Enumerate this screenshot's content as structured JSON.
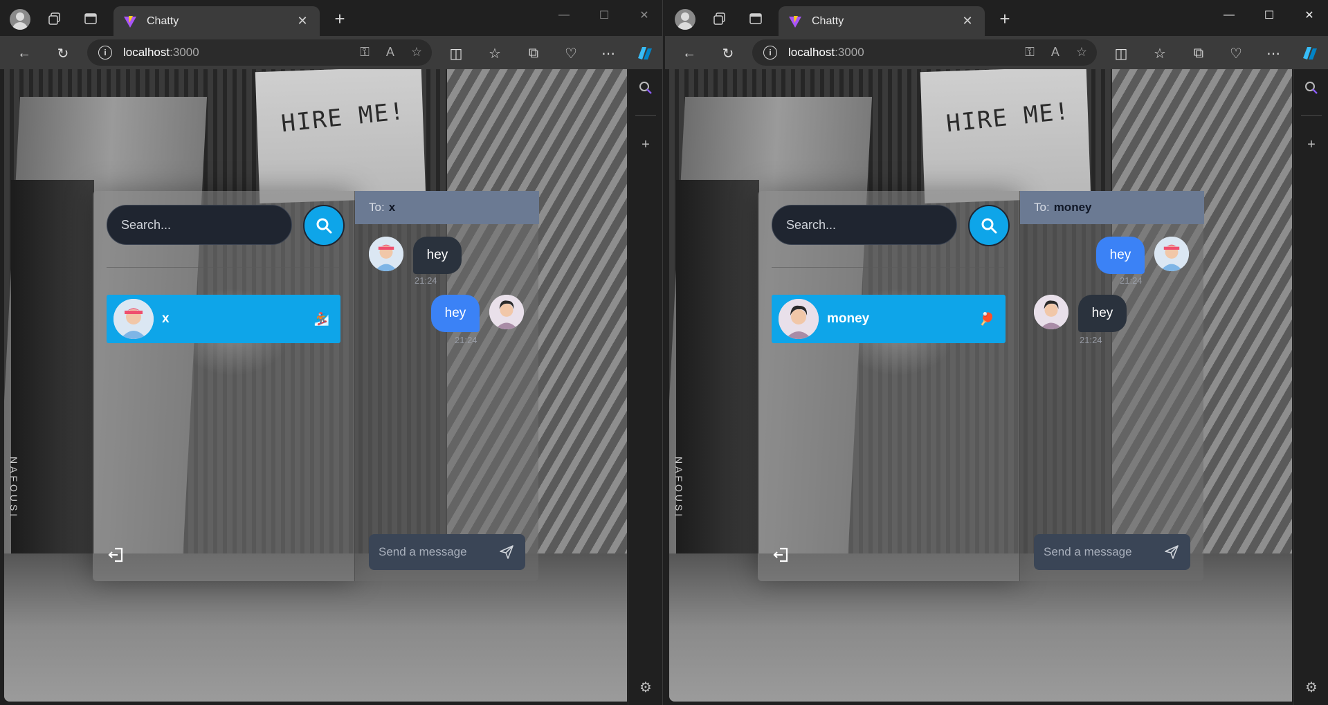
{
  "windows": [
    {
      "tab_title": "Chatty",
      "url_host": "localhost",
      "url_port": ":3000",
      "search_placeholder": "Search...",
      "conversation": {
        "name": "x",
        "emoji": "🏂"
      },
      "chat": {
        "to_label": "To:",
        "to_name": "x",
        "messages": [
          {
            "text": "hey",
            "time": "21:24",
            "side": "left"
          },
          {
            "text": "hey",
            "time": "21:24",
            "side": "right"
          }
        ],
        "input_placeholder": "Send a message"
      }
    },
    {
      "tab_title": "Chatty",
      "url_host": "localhost",
      "url_port": ":3000",
      "search_placeholder": "Search...",
      "conversation": {
        "name": "money",
        "emoji": "🏓"
      },
      "chat": {
        "to_label": "To:",
        "to_name": "money",
        "messages": [
          {
            "text": "hey",
            "time": "21:24",
            "side": "right"
          },
          {
            "text": "hey",
            "time": "21:24",
            "side": "left"
          }
        ],
        "input_placeholder": "Send a message"
      }
    }
  ],
  "background_text": {
    "hire": "HIRE ME!",
    "spine": "NAFOUSI"
  },
  "colors": {
    "accent": "#0ea5e9",
    "bubble_sent": "#3b82f6",
    "bubble_received": "#2a323d",
    "chat_header": "#6b7a93",
    "browser_chrome": "#202020",
    "toolbar": "#3b3b3b"
  },
  "icons": [
    "profile-icon",
    "collections-icon",
    "tab-actions-icon",
    "vite-favicon",
    "close-icon",
    "new-tab-icon",
    "minimize-icon",
    "maximize-icon",
    "back-icon",
    "refresh-icon",
    "info-icon",
    "key-icon",
    "read-aloud-icon",
    "favorite-star-icon",
    "split-screen-icon",
    "favorites-icon",
    "collections-add-icon",
    "browser-health-icon",
    "more-icon",
    "copilot-icon",
    "sidebar-search-icon",
    "sidebar-add-icon",
    "settings-icon",
    "search-icon",
    "logout-icon",
    "send-icon"
  ]
}
